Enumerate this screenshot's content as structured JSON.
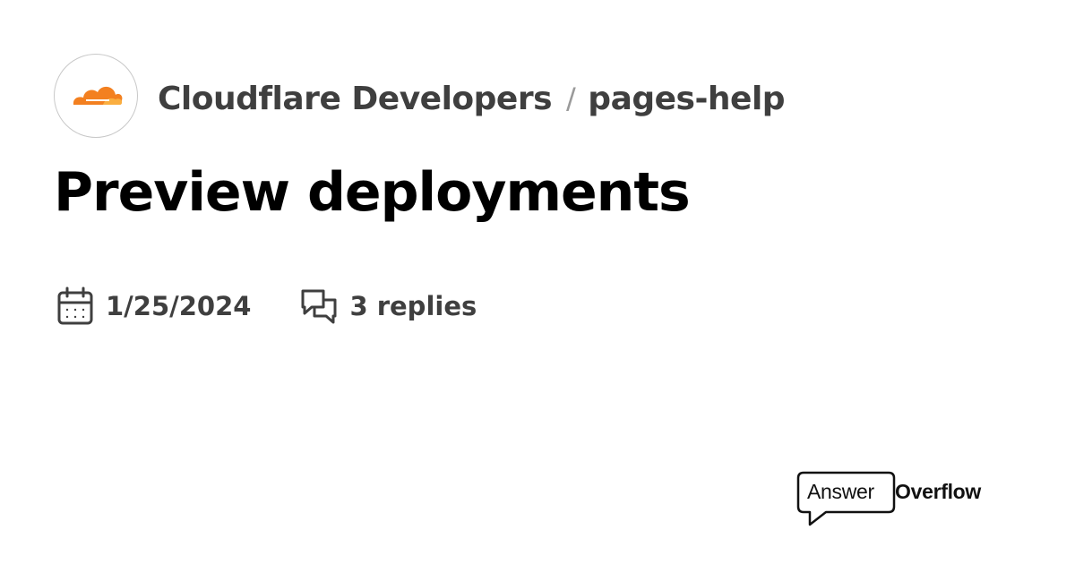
{
  "server": {
    "name": "Cloudflare Developers",
    "avatar_icon": "cloudflare-cloud-logo",
    "brand_color": "#f38020"
  },
  "channel": {
    "separator": "/",
    "name": "pages-help"
  },
  "thread": {
    "title": "Preview deployments",
    "date": "1/25/2024",
    "date_icon": "calendar-icon",
    "replies": "3 replies",
    "replies_icon": "chat-bubbles-icon"
  },
  "branding": {
    "answer": "Answer",
    "overflow": "Overflow",
    "icon": "speech-bubble-icon"
  }
}
